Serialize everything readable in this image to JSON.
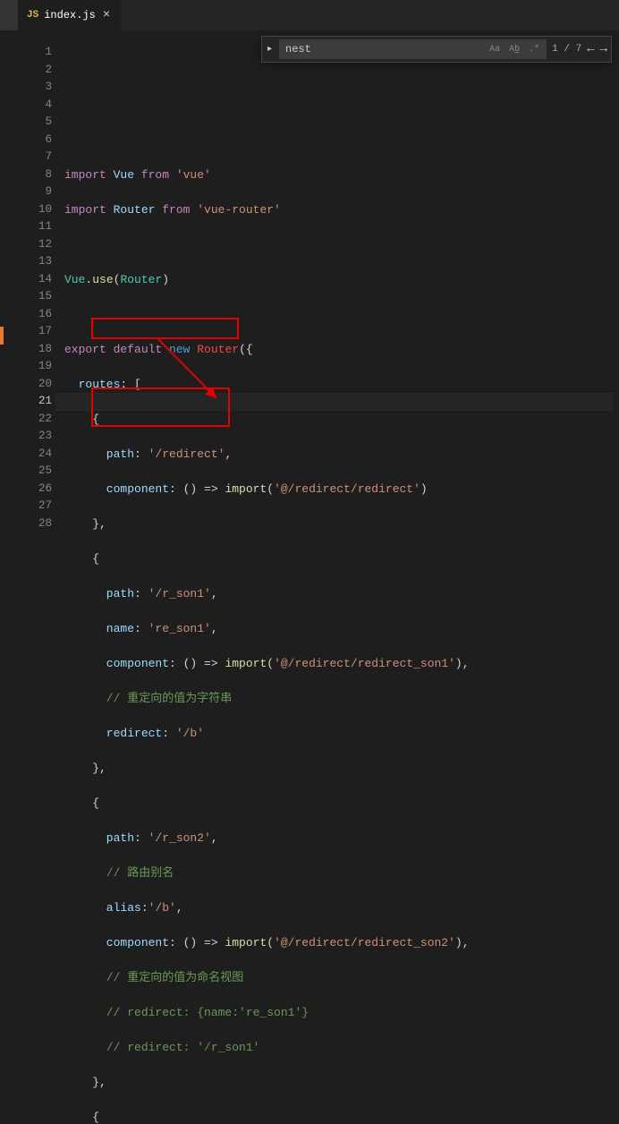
{
  "tab": {
    "icon_label": "JS",
    "filename": "index.js",
    "close_glyph": "×"
  },
  "find": {
    "expand_glyph": "▸",
    "query": "nest",
    "case_label": "Aa",
    "word_label": "Ab̲",
    "regex_label": ".*",
    "count": "1 / 7",
    "prev_glyph": "←",
    "next_glyph": "→",
    "close_glyph": "×"
  },
  "lines": {
    "start": 1,
    "end": 28,
    "active": 21
  },
  "code": {
    "l1_import": "import ",
    "l1_vue": "Vue",
    "l1_from": " from ",
    "l1_str": "'vue'",
    "l2_import": "import ",
    "l2_router": "Router",
    "l2_from": " from ",
    "l2_str": "'vue-router'",
    "l4_vue": "Vue",
    "l4_dot": ".",
    "l4_use": "use",
    "l4_p1": "(",
    "l4_routerCls": "Router",
    "l4_p2": ")",
    "l6_export": "export ",
    "l6_default": "default ",
    "l6_new": "new ",
    "l6_router": "Router",
    "l6_open": "({",
    "l7_routes": "  routes",
    "l7_colon": ": [",
    "l8_brace": "    {",
    "l9_path": "      path",
    "l9_val": ": ",
    "l9_str": "'/redirect'",
    "l9_comma": ",",
    "l10_comp": "      component",
    "l10_arrow": ": () => ",
    "l10_import": "import",
    "l10_p": "(",
    "l10_str": "'@/redirect/redirect'",
    "l10_p2": ")",
    "l11_close": "    },",
    "l12_open": "    {",
    "l13_path": "      path",
    "l13_val": ": ",
    "l13_str": "'/r_son1'",
    "l13_comma": ",",
    "l14_name": "      name",
    "l14_val": ": ",
    "l14_str": "'re_son1'",
    "l14_comma": ",",
    "l15_comp": "      component",
    "l15_arrow": ": () => ",
    "l15_import": "import",
    "l15_p": "(",
    "l15_str": "'@/redirect/redirect_son1'",
    "l15_p2": "),",
    "l16_comment": "      // 重定向的值为字符串",
    "l17_redirect": "      redirect",
    "l17_val": ": ",
    "l17_str": "'/b'",
    "l18_close": "    },",
    "l19_open": "    {",
    "l20_path": "      path",
    "l20_val": ": ",
    "l20_str": "'/r_son2'",
    "l20_comma": ",",
    "l21_comment": "      // 路由别名",
    "l22_alias": "      alias",
    "l22_val": ":",
    "l22_str": "'/b'",
    "l22_comma": ",",
    "l23_comp": "      component",
    "l23_arrow": ": () => ",
    "l23_import": "import",
    "l23_p": "(",
    "l23_str": "'@/redirect/redirect_son2'",
    "l23_p2": "),",
    "l24_comment": "      // 重定向的值为命名视图",
    "l25_comment": "      // redirect: {name:'re_son1'}",
    "l26_comment": "      // redirect: '/r_son1'",
    "l27_close": "    },",
    "l28_open": "    {"
  }
}
